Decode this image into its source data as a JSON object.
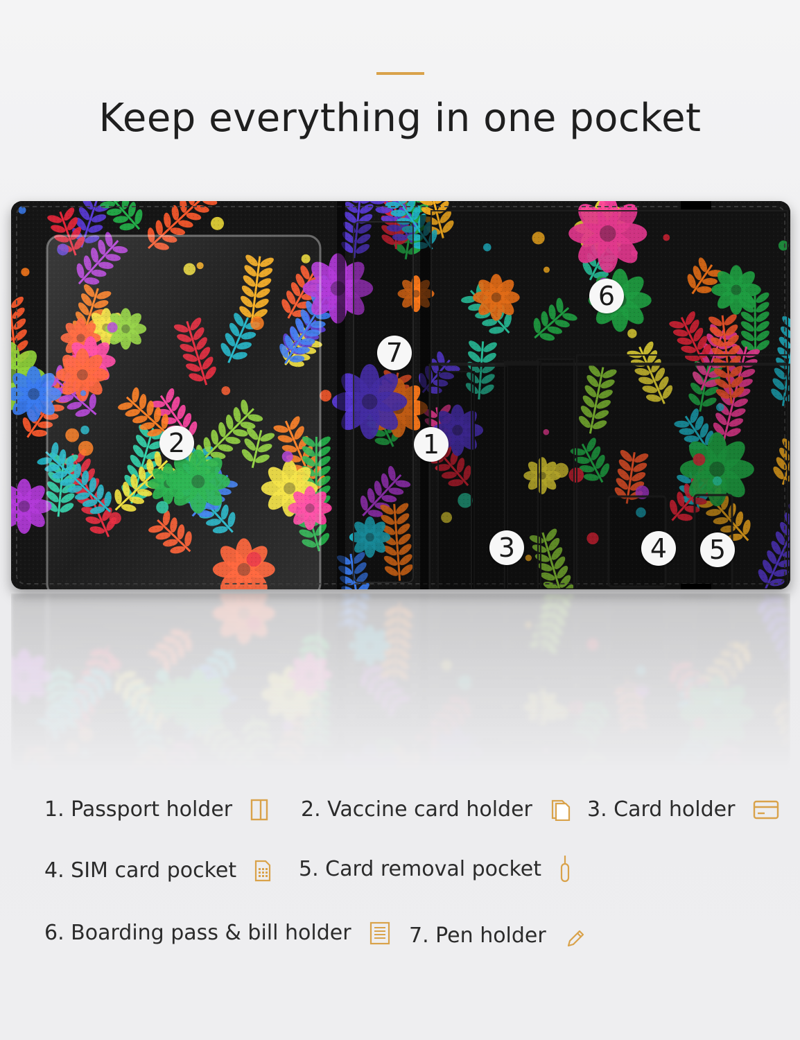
{
  "heading": {
    "title": "Keep everything in one pocket"
  },
  "colors": {
    "accent": "#d9a24a",
    "text": "#2b2b2b",
    "background": "#f1f1f2"
  },
  "badges": [
    "1",
    "2",
    "3",
    "4",
    "5",
    "6",
    "7"
  ],
  "features": [
    {
      "label": "1. Passport holder",
      "icon": "passport-icon"
    },
    {
      "label": "2. Vaccine card holder",
      "icon": "cards-stack-icon"
    },
    {
      "label": "3. Card holder",
      "icon": "credit-card-icon"
    },
    {
      "label": "4. SIM card pocket",
      "icon": "sim-card-icon"
    },
    {
      "label": "5. Card removal pocket",
      "icon": "sim-pin-icon"
    },
    {
      "label": "6. Boarding pass & bill holder",
      "icon": "document-icon"
    },
    {
      "label": "7. Pen holder",
      "icon": "pencil-icon"
    }
  ]
}
